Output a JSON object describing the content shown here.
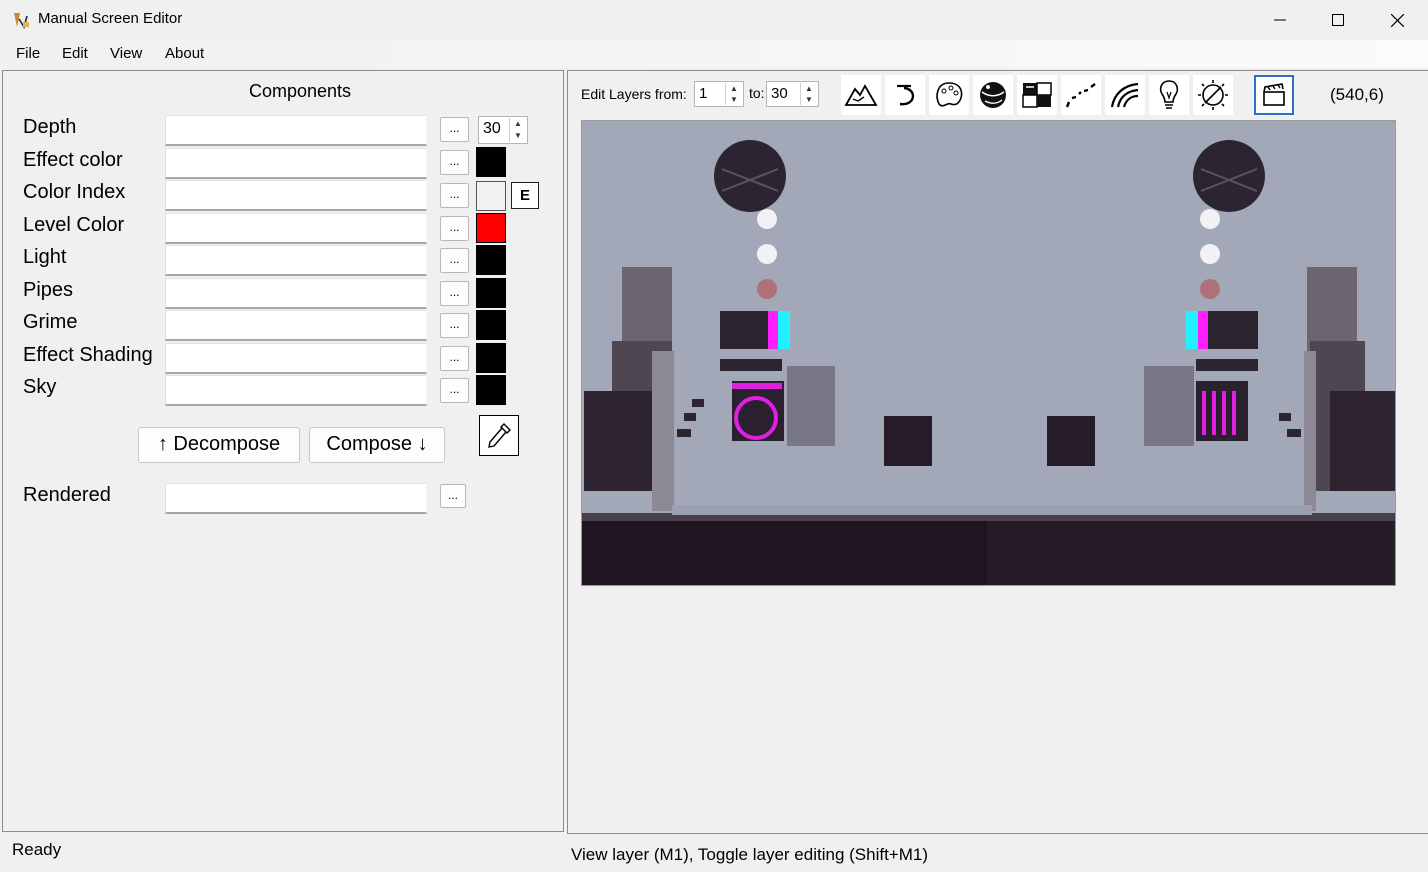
{
  "window": {
    "title": "Manual Screen Editor",
    "controls": [
      "minimize",
      "maximize",
      "close"
    ]
  },
  "menu": [
    "File",
    "Edit",
    "View",
    "About"
  ],
  "components": {
    "title": "Components",
    "rows": [
      {
        "label": "Depth",
        "color": null
      },
      {
        "label": "Effect color",
        "color": "#000000"
      },
      {
        "label": "Color Index",
        "color": "#f2f2f2"
      },
      {
        "label": "Level Color",
        "color": "#ff0000"
      },
      {
        "label": "Light",
        "color": "#000000"
      },
      {
        "label": "Pipes",
        "color": "#000000"
      },
      {
        "label": "Grime",
        "color": "#000000"
      },
      {
        "label": "Effect Shading",
        "color": "#000000"
      },
      {
        "label": "Sky",
        "color": "#000000"
      }
    ],
    "dots_label": "...",
    "depth_value": "30",
    "e_label": "E",
    "decompose_label": "↑ Decompose",
    "compose_label": "Compose ↓",
    "rendered_label": "Rendered"
  },
  "layers": {
    "edit_label": "Edit Layers from:",
    "from_value": "1",
    "to_label": "to:",
    "to_value": "30"
  },
  "tools": [
    "mountain-icon",
    "curve-icon",
    "palette-icon",
    "globe-icon",
    "tiles-icon",
    "path-icon",
    "wave-icon",
    "lightbulb-icon",
    "sun-icon",
    "clapper-icon"
  ],
  "coords": "(540,6)",
  "status": {
    "left": "Ready",
    "right": "View layer (M1), Toggle layer editing (Shift+M1)"
  }
}
